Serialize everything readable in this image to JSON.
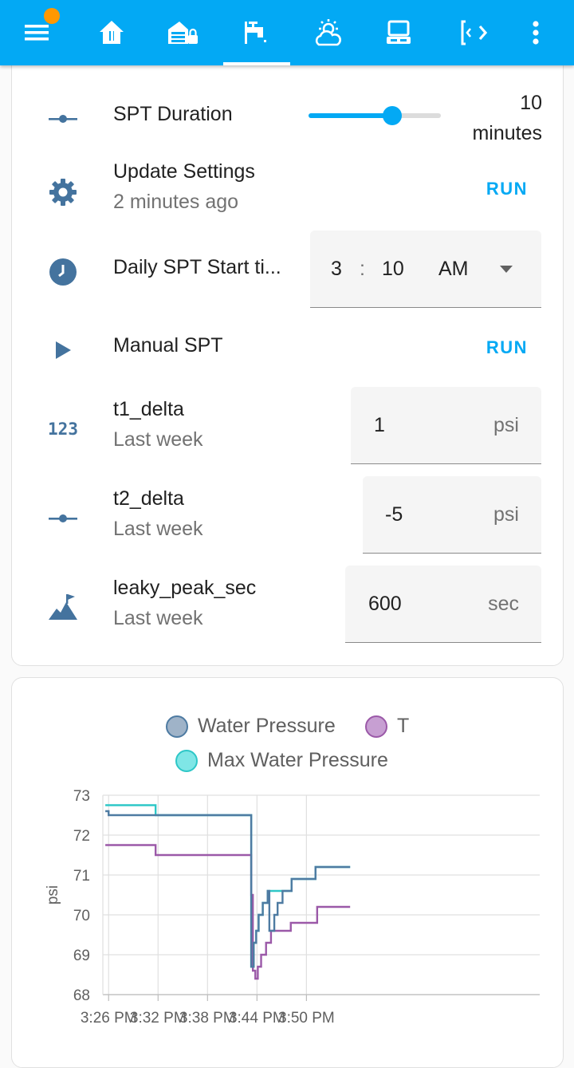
{
  "topbar": {
    "tabs": [
      {
        "icon": "menu-icon"
      },
      {
        "icon": "home-icon"
      },
      {
        "icon": "garage-lock-icon"
      },
      {
        "icon": "faucet-icon"
      },
      {
        "icon": "weather-partly-sunny-icon"
      },
      {
        "icon": "desktop-computer-icon"
      },
      {
        "icon": "code-brackets-icon"
      },
      {
        "icon": "more-vertical-icon"
      }
    ],
    "active_tab": 3,
    "colors": {
      "bar": "#03a9f4",
      "badge": "#ff9800"
    }
  },
  "settings": {
    "spt_duration": {
      "title": "SPT Duration",
      "value": "10",
      "unit": "minutes",
      "slider_fraction": 0.63
    },
    "update_settings": {
      "title": "Update Settings",
      "subtitle": "2 minutes ago",
      "action": "RUN"
    },
    "daily_start": {
      "title": "Daily SPT Start ti...",
      "hour": "3",
      "separator": ":",
      "minute": "10",
      "ampm": "AM"
    },
    "manual_spt": {
      "title": "Manual SPT",
      "action": "RUN"
    },
    "t1_delta": {
      "title": "t1_delta",
      "subtitle": "Last week",
      "value": "1",
      "unit": "psi",
      "icon_text": "123"
    },
    "t2_delta": {
      "title": "t2_delta",
      "subtitle": "Last week",
      "value": "-5",
      "unit": "psi"
    },
    "leaky_peak": {
      "title": "leaky_peak_sec",
      "subtitle": "Last week",
      "value": "600",
      "unit": "sec"
    }
  },
  "chart_data": {
    "type": "line",
    "ylabel": "psi",
    "ylim": [
      68,
      73
    ],
    "yticks": [
      "68",
      "69",
      "70",
      "71",
      "72",
      "73"
    ],
    "xlim_minutes": [
      206,
      259
    ],
    "xticks": [
      {
        "label": "3:26 PM",
        "m": 206.7
      },
      {
        "label": "3:32 PM",
        "m": 212.7
      },
      {
        "label": "3:38 PM",
        "m": 218.7
      },
      {
        "label": "3:44 PM",
        "m": 224.7
      },
      {
        "label": "3:50 PM",
        "m": 230.7
      }
    ],
    "grid": true,
    "legend_position": "top-center",
    "series": [
      {
        "name": "Water Pressure",
        "color": "#4e7ba2",
        "fill": "#9fb3c8",
        "points": [
          [
            206.3,
            72.6
          ],
          [
            206.7,
            72.5
          ],
          [
            223.8,
            72.5
          ],
          [
            224.0,
            68.7
          ],
          [
            224.3,
            69.3
          ],
          [
            224.6,
            69.6
          ],
          [
            224.9,
            70.0
          ],
          [
            225.4,
            70.3
          ],
          [
            226.0,
            70.6
          ],
          [
            226.2,
            69.6
          ],
          [
            226.8,
            70.0
          ],
          [
            227.2,
            70.3
          ],
          [
            227.8,
            70.6
          ],
          [
            228.9,
            70.9
          ],
          [
            231.8,
            71.2
          ],
          [
            236.0,
            71.2
          ]
        ],
        "step": true
      },
      {
        "name": "T",
        "color": "#9b59a8",
        "fill": "#c79fd2",
        "points": [
          [
            206.3,
            71.75
          ],
          [
            212.4,
            71.5
          ],
          [
            223.8,
            71.5
          ],
          [
            224.0,
            70.5
          ],
          [
            224.2,
            68.6
          ],
          [
            224.5,
            68.4
          ],
          [
            224.8,
            68.7
          ],
          [
            225.2,
            69.0
          ],
          [
            225.8,
            69.3
          ],
          [
            226.4,
            69.6
          ],
          [
            228.8,
            69.8
          ],
          [
            232.0,
            70.2
          ],
          [
            236.0,
            70.2
          ]
        ],
        "step": true
      },
      {
        "name": "Max Water Pressure",
        "color": "#2ec7c7",
        "fill": "#7fe6e6",
        "points": [
          [
            206.3,
            72.75
          ],
          [
            212.4,
            72.5
          ],
          [
            223.8,
            72.5
          ],
          [
            224.0,
            68.7
          ],
          [
            224.3,
            69.3
          ],
          [
            224.6,
            69.6
          ],
          [
            224.9,
            70.0
          ],
          [
            225.4,
            70.3
          ],
          [
            226.0,
            70.6
          ],
          [
            228.9,
            70.9
          ],
          [
            231.8,
            71.2
          ],
          [
            236.0,
            71.2
          ]
        ],
        "step": true
      }
    ]
  }
}
